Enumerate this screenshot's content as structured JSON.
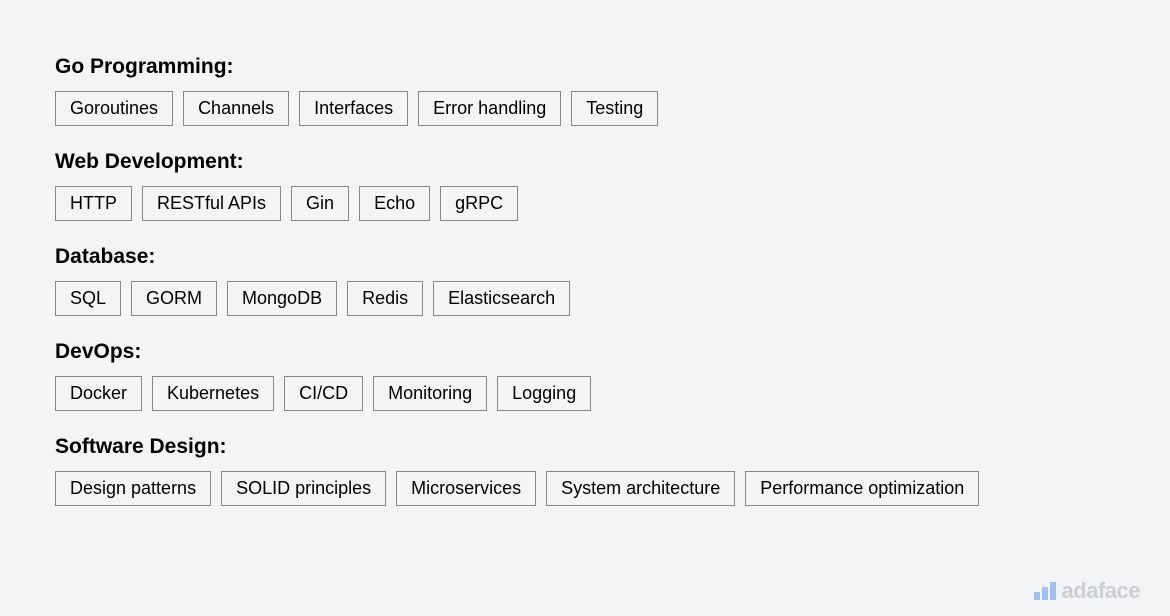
{
  "categories": [
    {
      "title": "Go Programming:",
      "tags": [
        "Goroutines",
        "Channels",
        "Interfaces",
        "Error handling",
        "Testing"
      ]
    },
    {
      "title": "Web Development:",
      "tags": [
        "HTTP",
        "RESTful APIs",
        "Gin",
        "Echo",
        "gRPC"
      ]
    },
    {
      "title": "Database:",
      "tags": [
        "SQL",
        "GORM",
        "MongoDB",
        "Redis",
        "Elasticsearch"
      ]
    },
    {
      "title": "DevOps:",
      "tags": [
        "Docker",
        "Kubernetes",
        "CI/CD",
        "Monitoring",
        "Logging"
      ]
    },
    {
      "title": "Software Design:",
      "tags": [
        "Design patterns",
        "SOLID principles",
        "Microservices",
        "System architecture",
        "Performance optimization"
      ]
    }
  ],
  "watermark": {
    "text": "adaface"
  }
}
